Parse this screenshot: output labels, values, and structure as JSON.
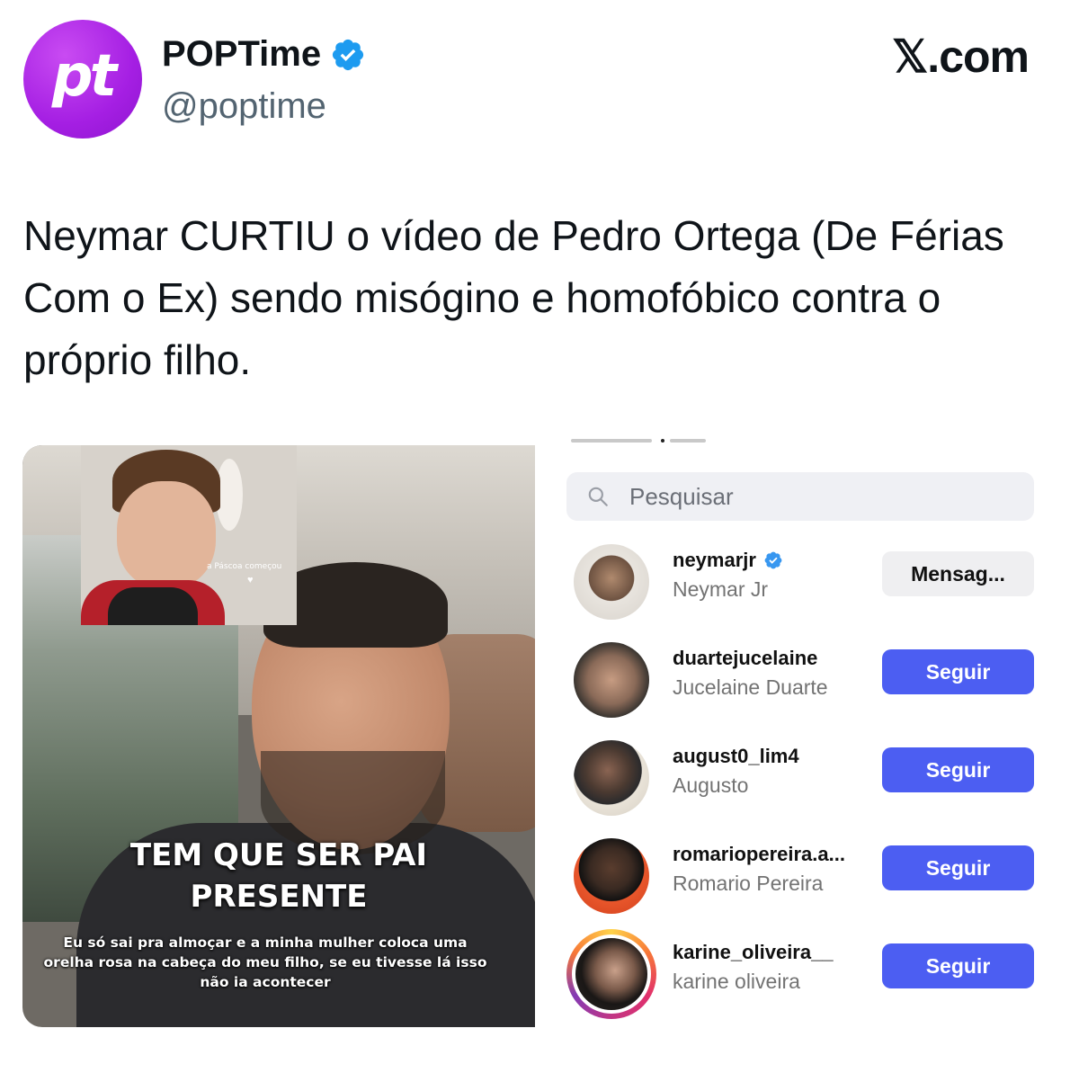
{
  "header": {
    "avatar_text": "pt",
    "name": "POPTime",
    "handle": "@poptime",
    "site": "𝕏.com"
  },
  "post": {
    "text": "Neymar CURTIU o vídeo de Pedro Ortega (De Férias Com o Ex) sendo misógino e homofóbico contra o próprio filho."
  },
  "video": {
    "inset_caption": "a Páscoa começou",
    "inset_heart": "♥",
    "title_line1": "TEM QUE SER PAI",
    "title_line2": "PRESENTE",
    "subtitle": "Eu só sai pra almoçar e a minha mulher coloca uma orelha rosa na cabeça do meu filho, se eu tivesse lá isso não ia acontecer"
  },
  "likes_list": {
    "search_placeholder": "Pesquisar",
    "users": [
      {
        "username": "neymarjr",
        "full_name": "Neymar Jr",
        "verified": true,
        "button": "Mensag..."
      },
      {
        "username": "duartejucelaine",
        "full_name": "Jucelaine Duarte",
        "verified": false,
        "button": "Seguir"
      },
      {
        "username": "august0_lim4",
        "full_name": "Augusto",
        "verified": false,
        "button": "Seguir"
      },
      {
        "username": "romariopereira.a...",
        "full_name": "Romario Pereira",
        "verified": false,
        "button": "Seguir"
      },
      {
        "username": "karine_oliveira__",
        "full_name": "karine oliveira",
        "verified": false,
        "button": "Seguir"
      }
    ]
  },
  "colors": {
    "brand_purple": "#a51fe3",
    "verified_blue": "#1d9bf0",
    "follow_button": "#4c5ef2",
    "message_button": "#efeff1"
  }
}
